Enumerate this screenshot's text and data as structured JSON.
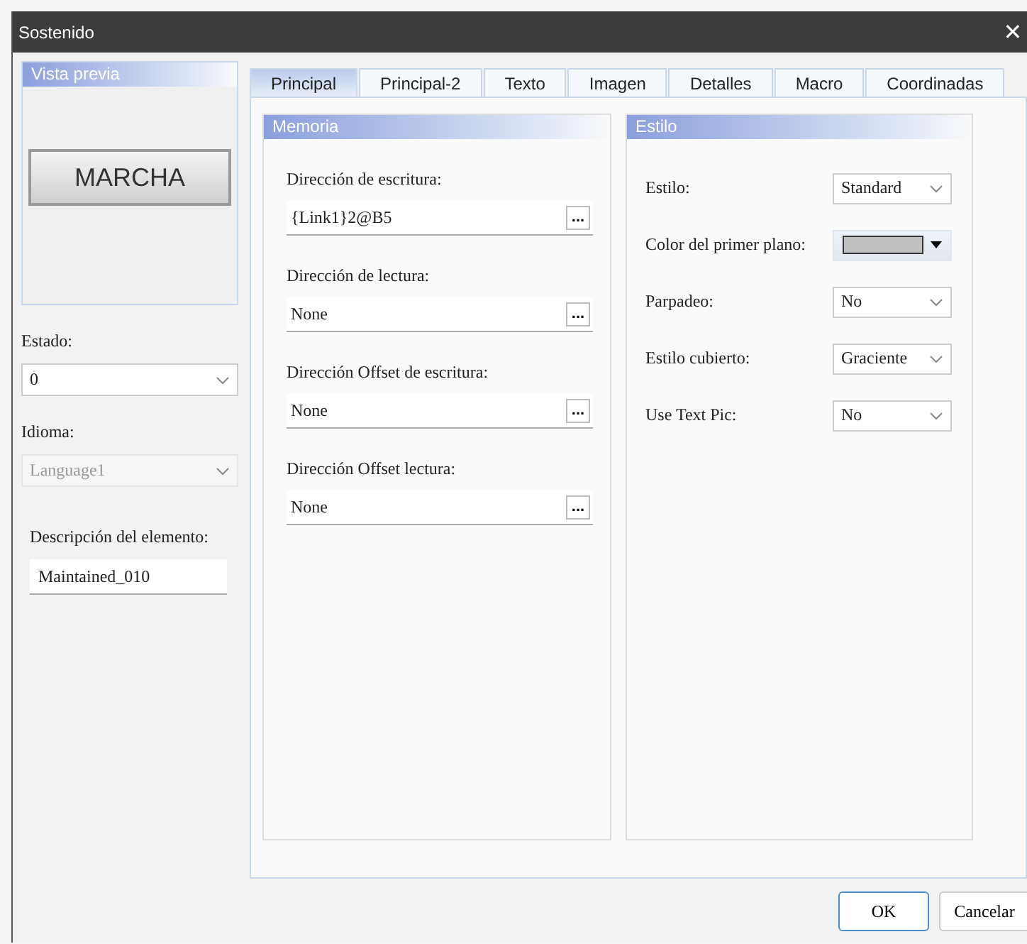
{
  "window": {
    "title": "Sostenido",
    "close": "✕"
  },
  "preview": {
    "title": "Vista previa",
    "button_label": "MARCHA"
  },
  "left_fields": [
    {
      "kind": "select",
      "label": "Estado:",
      "value": "0",
      "disabled": false
    },
    {
      "kind": "select",
      "label": "Idioma:",
      "value": "Language1",
      "disabled": true
    },
    {
      "kind": "text",
      "label": "Descripción del elemento:",
      "value": "Maintained_010",
      "disabled": false
    }
  ],
  "tabs": [
    {
      "label": "Principal",
      "selected": true
    },
    {
      "label": "Principal-2",
      "selected": false
    },
    {
      "label": "Texto",
      "selected": false
    },
    {
      "label": "Imagen",
      "selected": false
    },
    {
      "label": "Detalles",
      "selected": false
    },
    {
      "label": "Macro",
      "selected": false
    },
    {
      "label": "Coordinadas",
      "selected": false
    }
  ],
  "memoria": {
    "title": "Memoria",
    "fields": [
      {
        "label": "Dirección de escritura:",
        "value": "{Link1}2@B5",
        "button": "..."
      },
      {
        "label": "Dirección de lectura:",
        "value": "None",
        "button": "..."
      },
      {
        "label": "Dirección Offset de escritura:",
        "value": "None",
        "button": "..."
      },
      {
        "label": "Dirección Offset lectura:",
        "value": "None",
        "button": "..."
      }
    ]
  },
  "estilo": {
    "title": "Estilo",
    "rows": [
      {
        "kind": "select",
        "label": "Estilo:",
        "value": "Standard"
      },
      {
        "kind": "color",
        "label": "Color del primer plano:",
        "color": "#c0c0c0"
      },
      {
        "kind": "select",
        "label": "Parpadeo:",
        "value": "No"
      },
      {
        "kind": "select",
        "label": "Estilo cubierto:",
        "value": "Graciente"
      },
      {
        "kind": "select",
        "label": "Use Text Pic:",
        "value": "No"
      }
    ]
  },
  "buttons": [
    {
      "label": "OK",
      "default": true
    },
    {
      "label": "Cancelar",
      "default": false
    }
  ]
}
